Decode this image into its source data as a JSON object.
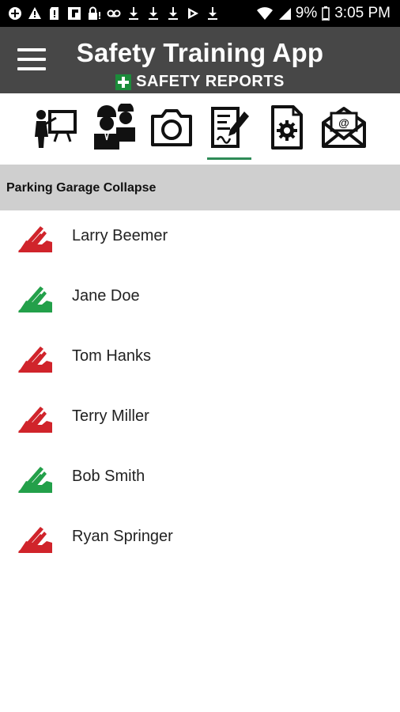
{
  "status_bar": {
    "battery": "9%",
    "time": "3:05 PM",
    "left_icons": [
      "add-circle-icon",
      "warning-icon",
      "sd-card-alert-icon",
      "flipboard-icon",
      "lock-warning-icon",
      "voicemail-icon",
      "download-icon",
      "download-icon",
      "download-icon",
      "play-store-icon",
      "download-icon"
    ]
  },
  "app_bar": {
    "title": "Safety Training App",
    "brand": "SAFETY REPORTS",
    "brand_color": "#1b8c3a"
  },
  "toolbar": {
    "items": [
      {
        "icon": "trainer-presentation-icon"
      },
      {
        "icon": "workers-group-icon"
      },
      {
        "icon": "camera-icon"
      },
      {
        "icon": "sign-document-icon",
        "active": true
      },
      {
        "icon": "settings-document-icon"
      },
      {
        "icon": "email-icon"
      }
    ]
  },
  "section": {
    "title": "Parking Garage Collapse"
  },
  "attendees": [
    {
      "name": "Larry Beemer",
      "signed": false,
      "color": "#d0242b"
    },
    {
      "name": "Jane Doe",
      "signed": true,
      "color": "#23a04a"
    },
    {
      "name": "Tom Hanks",
      "signed": false,
      "color": "#d0242b"
    },
    {
      "name": "Terry Miller",
      "signed": false,
      "color": "#d0242b"
    },
    {
      "name": "Bob Smith",
      "signed": true,
      "color": "#23a04a"
    },
    {
      "name": "Ryan Springer",
      "signed": false,
      "color": "#d0242b"
    }
  ]
}
